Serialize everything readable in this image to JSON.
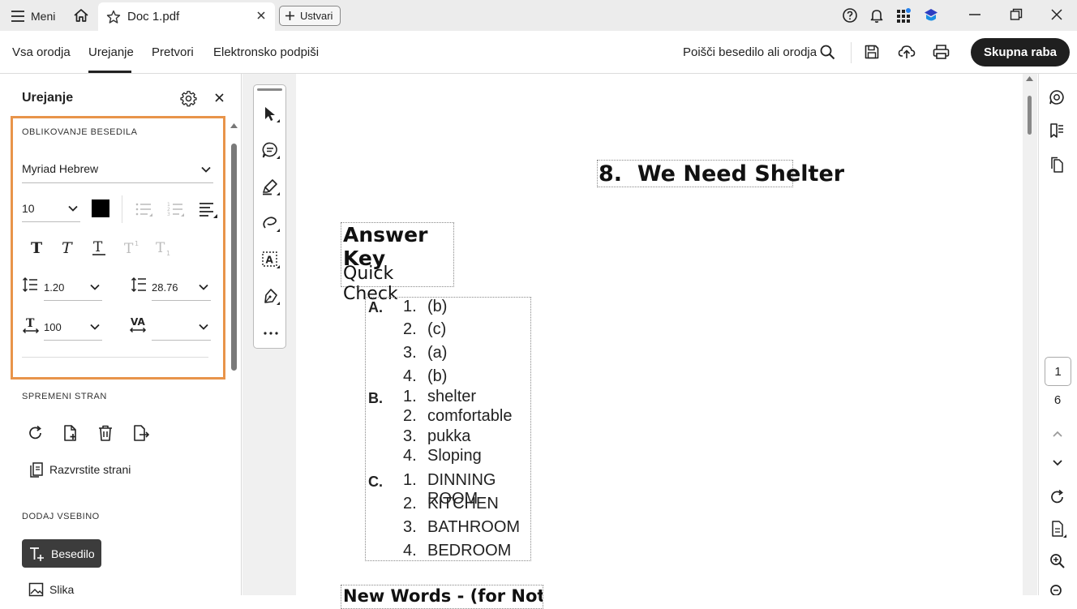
{
  "titlebar": {
    "menu_label": "Meni",
    "tab_title": "Doc 1.pdf",
    "create_label": "Ustvari"
  },
  "toolbar": {
    "tabs": [
      "Vsa orodja",
      "Urejanje",
      "Pretvori",
      "Elektronsko podpiši"
    ],
    "active_tab": "Urejanje",
    "search_label": "Poišči besedilo ali orodja",
    "share_label": "Skupna raba"
  },
  "panel": {
    "title": "Urejanje",
    "text_format": {
      "section_label": "OBLIKOVANJE BESEDILA",
      "font_family": "Myriad Hebrew",
      "font_size": "10",
      "color": "#000000",
      "line_spacing": "1.20",
      "paragraph_spacing": "28.76",
      "horizontal_scale": "100",
      "char_spacing": ""
    },
    "page_section_label": "SPREMENI STRAN",
    "arrange_pages_label": "Razvrstite strani",
    "add_content_label": "DODAJ VSEBINO",
    "add_text_label": "Besedilo",
    "add_image_label": "Slika"
  },
  "document": {
    "heading": "8.  We Need Shelter",
    "answer_key": "Answer Key",
    "quick_check": "Quick Check",
    "groups": [
      {
        "letter": "A.",
        "items": [
          "1.",
          "2.",
          "3.",
          "4."
        ],
        "answers": [
          "(b)",
          "(c)",
          "(a)",
          "(b)"
        ]
      },
      {
        "letter": "B.",
        "items": [
          "1.",
          "2.",
          "3.",
          "4."
        ],
        "answers": [
          "shelter",
          "comfortable",
          "pukka",
          "Sloping"
        ]
      },
      {
        "letter": "C.",
        "items": [
          "1.",
          "2.",
          "3.",
          "4."
        ],
        "answers": [
          "DINNING ROOM",
          "KITCHEN",
          "BATHROOM",
          "BEDROOM"
        ]
      }
    ],
    "cut_off_line": "New Words - (for Notebook)"
  },
  "pagination": {
    "current": "1",
    "total": "6"
  },
  "colors": {
    "highlight_border": "#e8944a",
    "share_button": "#1f1f1f"
  }
}
